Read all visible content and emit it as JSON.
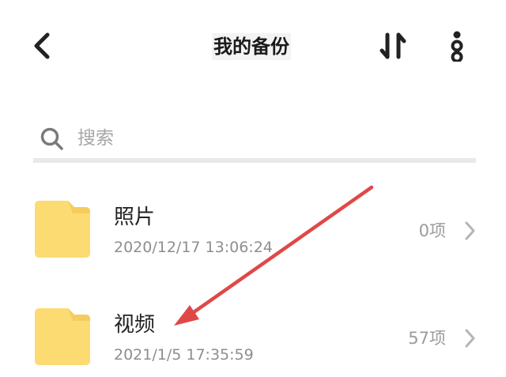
{
  "header": {
    "title": "我的备份"
  },
  "search": {
    "placeholder": "搜索"
  },
  "items": [
    {
      "name": "照片",
      "date": "2020/12/17 13:06:24",
      "count": "0项"
    },
    {
      "name": "视频",
      "date": "2021/1/5 17:35:59",
      "count": "57项"
    }
  ],
  "colors": {
    "folder": "#fcdb73",
    "folder_tab": "#f5cd5e",
    "annotation_arrow": "#e04848",
    "separator": "#e9e9e9"
  },
  "icons": [
    "back-icon",
    "sort-icon",
    "more-icon",
    "search-icon",
    "folder-icon",
    "chevron-right-icon"
  ]
}
